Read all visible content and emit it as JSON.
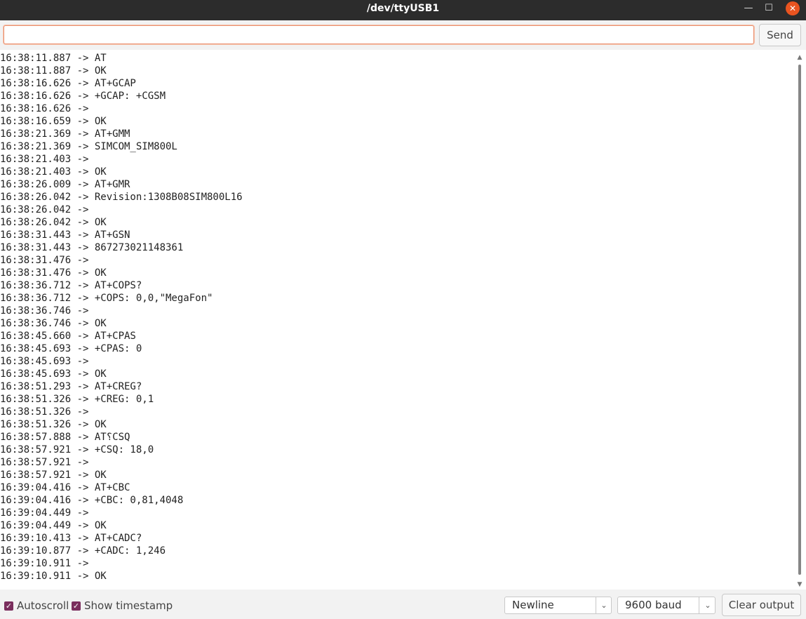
{
  "window": {
    "title": "/dev/ttyUSB1",
    "minimize_glyph": "—",
    "maximize_glyph": "☐",
    "close_glyph": "✕"
  },
  "input": {
    "value": "",
    "placeholder": "",
    "send_label": "Send"
  },
  "output": {
    "lines": [
      "16:38:11.887 -> AT",
      "16:38:11.887 -> OK",
      "16:38:16.626 -> AT+GCAP",
      "16:38:16.626 -> +GCAP: +CGSM",
      "16:38:16.626 -> ",
      "16:38:16.659 -> OK",
      "16:38:21.369 -> AT+GMM",
      "16:38:21.369 -> SIMCOM_SIM800L",
      "16:38:21.403 -> ",
      "16:38:21.403 -> OK",
      "16:38:26.009 -> AT+GMR",
      "16:38:26.042 -> Revision:1308B08SIM800L16",
      "16:38:26.042 -> ",
      "16:38:26.042 -> OK",
      "16:38:31.443 -> AT+GSN",
      "16:38:31.443 -> 867273021148361",
      "16:38:31.476 -> ",
      "16:38:31.476 -> OK",
      "16:38:36.712 -> AT+COPS?",
      "16:38:36.712 -> +COPS: 0,0,\"MegaFon\"",
      "16:38:36.746 -> ",
      "16:38:36.746 -> OK",
      "16:38:45.660 -> AT+CPAS",
      "16:38:45.693 -> +CPAS: 0",
      "16:38:45.693 -> ",
      "16:38:45.693 -> OK",
      "16:38:51.293 -> AT+CREG?",
      "16:38:51.326 -> +CREG: 0,1",
      "16:38:51.326 -> ",
      "16:38:51.326 -> OK",
      "16:38:57.888 -> AT؟CSQ",
      "16:38:57.921 -> +CSQ: 18,0",
      "16:38:57.921 -> ",
      "16:38:57.921 -> OK",
      "16:39:04.416 -> AT+CBC",
      "16:39:04.416 -> +CBC: 0,81,4048",
      "16:39:04.449 -> ",
      "16:39:04.449 -> OK",
      "16:39:10.413 -> AT+CADC?",
      "16:39:10.877 -> +CADC: 1,246",
      "16:39:10.911 -> ",
      "16:39:10.911 -> OK"
    ]
  },
  "footer": {
    "autoscroll_label": "Autoscroll",
    "autoscroll_checked": true,
    "timestamp_label": "Show timestamp",
    "timestamp_checked": true,
    "line_ending": "Newline",
    "baud": "9600 baud",
    "clear_label": "Clear output",
    "check_glyph": "✓",
    "chevron_glyph": "⌄"
  },
  "colors": {
    "titlebar": "#2c2c2c",
    "close_button": "#e95420",
    "checkbox": "#7a2e5d",
    "input_focus_border": "#e9906f"
  }
}
